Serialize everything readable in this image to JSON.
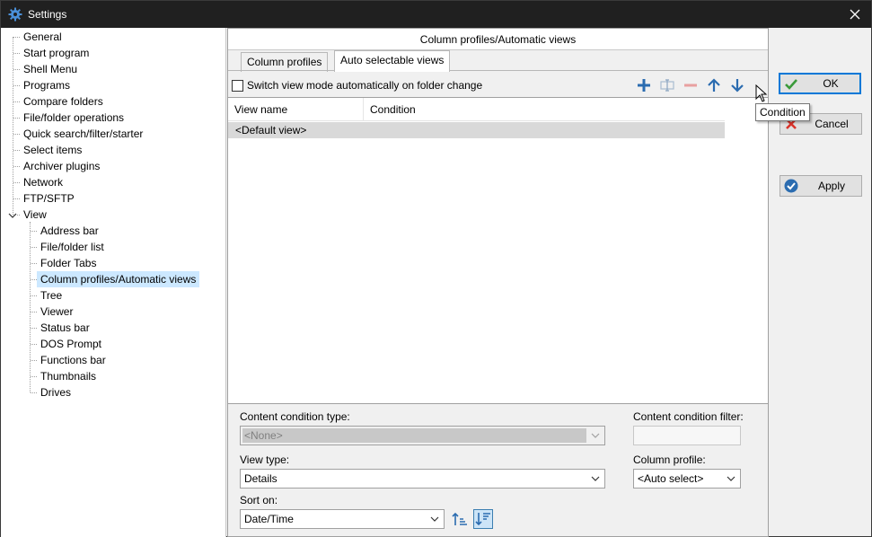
{
  "window": {
    "title": "Settings"
  },
  "tree": {
    "items": [
      {
        "label": "General",
        "level": 0
      },
      {
        "label": "Start program",
        "level": 0
      },
      {
        "label": "Shell Menu",
        "level": 0
      },
      {
        "label": "Programs",
        "level": 0
      },
      {
        "label": "Compare folders",
        "level": 0
      },
      {
        "label": "File/folder operations",
        "level": 0
      },
      {
        "label": "Quick search/filter/starter",
        "level": 0
      },
      {
        "label": "Select items",
        "level": 0
      },
      {
        "label": "Archiver plugins",
        "level": 0
      },
      {
        "label": "Network",
        "level": 0
      },
      {
        "label": "FTP/SFTP",
        "level": 0
      },
      {
        "label": "View",
        "level": 0,
        "expanded": true
      },
      {
        "label": "Address bar",
        "level": 1
      },
      {
        "label": "File/folder list",
        "level": 1
      },
      {
        "label": "Folder Tabs",
        "level": 1
      },
      {
        "label": "Column profiles/Automatic views",
        "level": 1,
        "selected": true
      },
      {
        "label": "Tree",
        "level": 1
      },
      {
        "label": "Viewer",
        "level": 1
      },
      {
        "label": "Status bar",
        "level": 1
      },
      {
        "label": "DOS Prompt",
        "level": 1
      },
      {
        "label": "Functions bar",
        "level": 1
      },
      {
        "label": "Thumbnails",
        "level": 1
      },
      {
        "label": "Drives",
        "level": 1
      }
    ]
  },
  "panel": {
    "header": "Column profiles/Automatic views",
    "tabs": [
      {
        "label": "Column profiles",
        "active": false
      },
      {
        "label": "Auto selectable views",
        "active": true
      }
    ],
    "switch_checkbox": {
      "label": "Switch view mode automatically on folder change",
      "checked": false
    },
    "toolbar": {
      "add": "plus-icon",
      "edit": "edit-icon",
      "remove": "minus-icon",
      "up": "arrow-up-icon",
      "down": "arrow-down-icon"
    },
    "grid": {
      "columns": [
        "View name",
        "Condition"
      ],
      "rows": [
        {
          "view_name": "<Default view>",
          "condition": ""
        }
      ]
    },
    "content_condition_type": {
      "label": "Content condition type:",
      "value": "<None>"
    },
    "content_condition_filter": {
      "label": "Content condition filter:",
      "value": ""
    },
    "view_type": {
      "label": "View type:",
      "value": "Details"
    },
    "column_profile": {
      "label": "Column profile:",
      "value": "<Auto select>"
    },
    "sort_on": {
      "label": "Sort on:",
      "value": "Date/Time"
    }
  },
  "buttons": {
    "ok": "OK",
    "cancel": "Cancel",
    "apply": "Apply"
  },
  "tooltip": "Condition",
  "colors": {
    "accent": "#0078d7",
    "toolbar_icon": "#2b6cb0",
    "selection": "#cce8ff",
    "ok_check": "#3a9a3a",
    "cancel_x": "#d9342b"
  }
}
